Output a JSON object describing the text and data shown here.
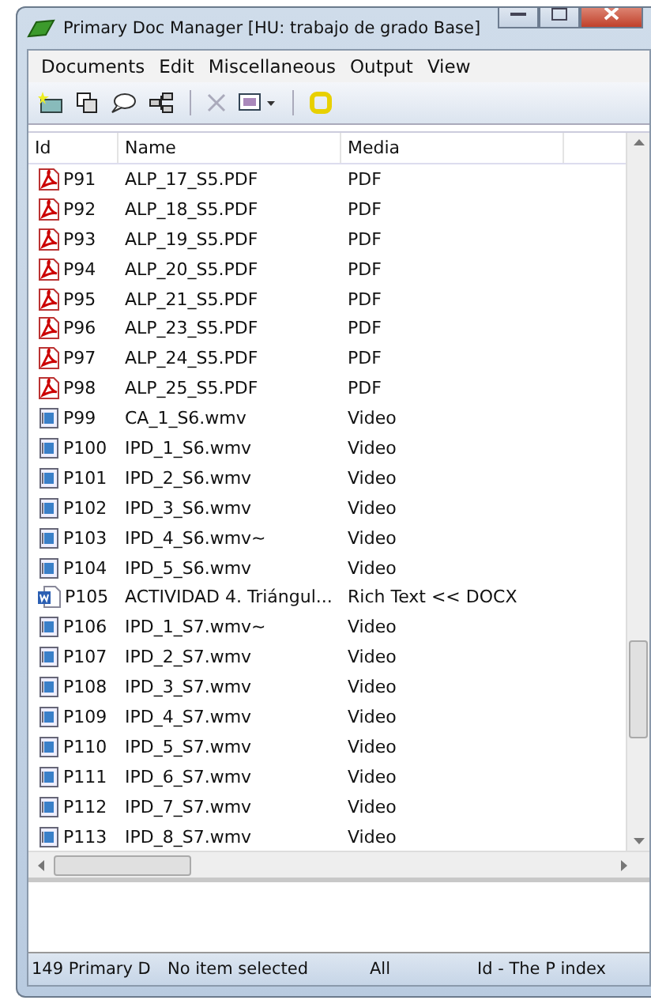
{
  "window": {
    "title": "Primary Doc Manager [HU: trabajo de grado Base]"
  },
  "menu": [
    "Documents",
    "Edit",
    "Miscellaneous",
    "Output",
    "View"
  ],
  "table": {
    "columns": [
      "Id",
      "Name",
      "Media"
    ],
    "rows": [
      {
        "kind": "pdf",
        "id": "P91",
        "name": "ALP_17_S5.PDF",
        "media": "PDF"
      },
      {
        "kind": "pdf",
        "id": "P92",
        "name": "ALP_18_S5.PDF",
        "media": "PDF"
      },
      {
        "kind": "pdf",
        "id": "P93",
        "name": "ALP_19_S5.PDF",
        "media": "PDF"
      },
      {
        "kind": "pdf",
        "id": "P94",
        "name": "ALP_20_S5.PDF",
        "media": "PDF"
      },
      {
        "kind": "pdf",
        "id": "P95",
        "name": "ALP_21_S5.PDF",
        "media": "PDF"
      },
      {
        "kind": "pdf",
        "id": "P96",
        "name": "ALP_23_S5.PDF",
        "media": "PDF"
      },
      {
        "kind": "pdf",
        "id": "P97",
        "name": "ALP_24_S5.PDF",
        "media": "PDF"
      },
      {
        "kind": "pdf",
        "id": "P98",
        "name": "ALP_25_S5.PDF",
        "media": "PDF"
      },
      {
        "kind": "video",
        "id": "P99",
        "name": "CA_1_S6.wmv",
        "media": "Video"
      },
      {
        "kind": "video",
        "id": "P100",
        "name": "IPD_1_S6.wmv",
        "media": "Video"
      },
      {
        "kind": "video",
        "id": "P101",
        "name": "IPD_2_S6.wmv",
        "media": "Video"
      },
      {
        "kind": "video",
        "id": "P102",
        "name": "IPD_3_S6.wmv",
        "media": "Video"
      },
      {
        "kind": "video",
        "id": "P103",
        "name": "IPD_4_S6.wmv~",
        "media": "Video"
      },
      {
        "kind": "video",
        "id": "P104",
        "name": "IPD_5_S6.wmv",
        "media": "Video"
      },
      {
        "kind": "word",
        "id": "P105",
        "name": "ACTIVIDAD 4. Triángul...",
        "media": "Rich Text << DOCX"
      },
      {
        "kind": "video",
        "id": "P106",
        "name": "IPD_1_S7.wmv~",
        "media": "Video"
      },
      {
        "kind": "video",
        "id": "P107",
        "name": "IPD_2_S7.wmv",
        "media": "Video"
      },
      {
        "kind": "video",
        "id": "P108",
        "name": "IPD_3_S7.wmv",
        "media": "Video"
      },
      {
        "kind": "video",
        "id": "P109",
        "name": "IPD_4_S7.wmv",
        "media": "Video"
      },
      {
        "kind": "video",
        "id": "P110",
        "name": "IPD_5_S7.wmv",
        "media": "Video"
      },
      {
        "kind": "video",
        "id": "P111",
        "name": "IPD_6_S7.wmv",
        "media": "Video"
      },
      {
        "kind": "video",
        "id": "P112",
        "name": "IPD_7_S7.wmv",
        "media": "Video"
      },
      {
        "kind": "video",
        "id": "P113",
        "name": "IPD_8_S7.wmv",
        "media": "Video"
      }
    ]
  },
  "status_bar": [
    "149 Primary D",
    "No item selected",
    "All",
    "Id - The P index"
  ]
}
